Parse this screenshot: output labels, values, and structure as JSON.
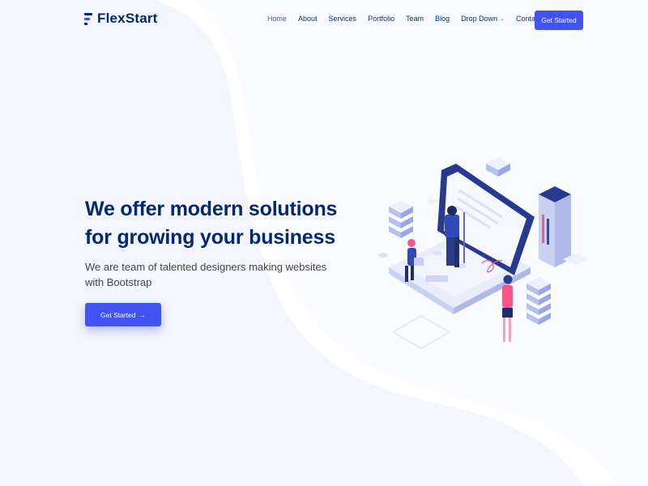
{
  "brand": {
    "name": "FlexStart"
  },
  "nav": {
    "items": [
      {
        "label": "Home",
        "active": true
      },
      {
        "label": "About",
        "active": false
      },
      {
        "label": "Services",
        "active": false
      },
      {
        "label": "Portfolio",
        "active": false
      },
      {
        "label": "Team",
        "active": false
      },
      {
        "label": "Blog",
        "active": false
      },
      {
        "label": "Drop Down",
        "active": false,
        "has_dropdown": true
      },
      {
        "label": "Contact",
        "active": false
      }
    ],
    "cta_label": "Get Started"
  },
  "hero": {
    "title_line1": "We offer modern solutions",
    "title_line2": "for growing your business",
    "subtitle_line1": "We are team of talented designers making websites",
    "subtitle_line2": "with Bootstrap",
    "button_label": "Get Started",
    "button_icon": "arrow-right-icon"
  },
  "colors": {
    "primary": "#4154f1",
    "heading": "#012970",
    "background_wave": "#f5f7fd"
  }
}
